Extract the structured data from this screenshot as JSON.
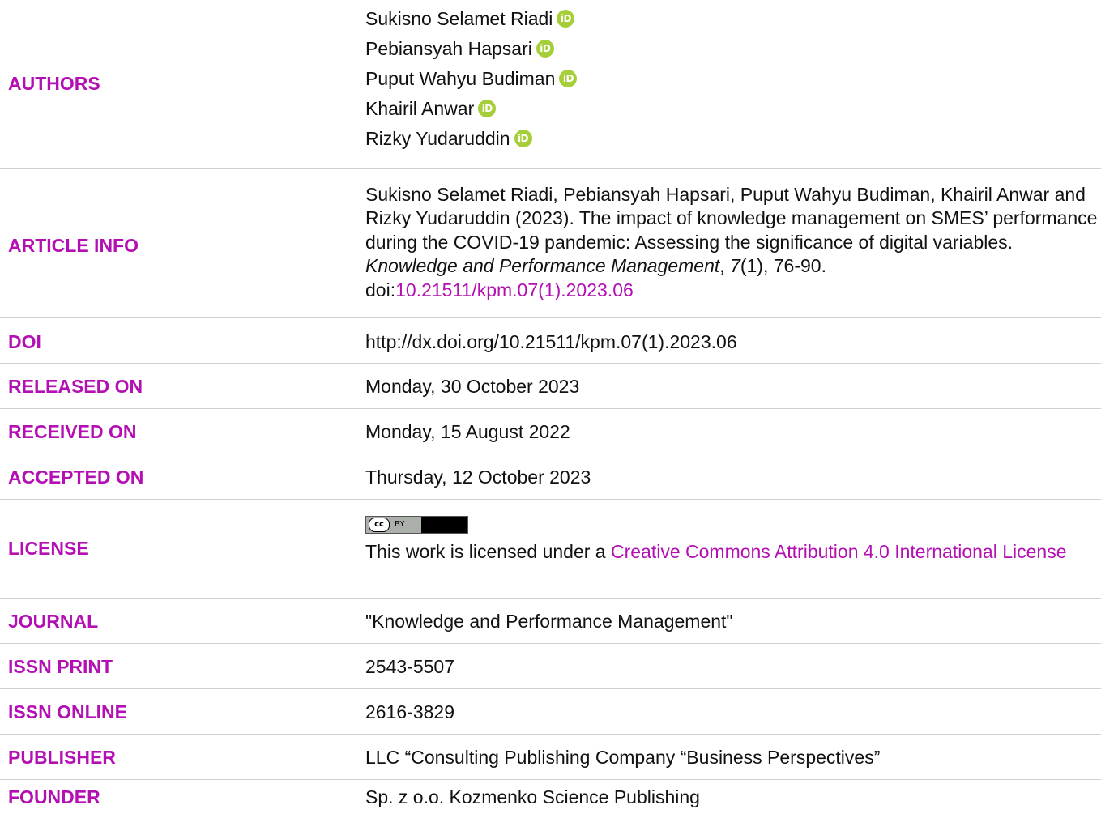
{
  "authors": {
    "label": "AUTHORS",
    "names": [
      "Sukisno Selamet Riadi",
      "Pebiansyah Hapsari",
      "Puput Wahyu Budiman",
      "Khairil Anwar",
      "Rizky Yudaruddin"
    ],
    "orcid_icon_text": "iD",
    "orcid_color": "#a6ce39"
  },
  "article_info": {
    "label": "ARTICLE INFO",
    "citation_start": "Sukisno Selamet Riadi, Pebiansyah Hapsari, Puput Wahyu Budiman, Khairil Anwar and Rizky Yudaruddin (2023). The impact of knowledge management on SMES’ performance during the COVID-19 pandemic: Assessing the significance of digital variables. ",
    "journal_italic": "Knowledge and Performance Management",
    "comma1": ", ",
    "volume_italic": "7",
    "pages": "(1), 76-90.",
    "doi_prefix": "doi:",
    "doi_link": "10.21511/kpm.07(1).2023.06"
  },
  "doi": {
    "label": "DOI",
    "value": "http://dx.doi.org/10.21511/kpm.07(1).2023.06"
  },
  "released": {
    "label": "RELEASED ON",
    "value": "Monday, 30 October 2023"
  },
  "received": {
    "label": "RECEIVED ON",
    "value": "Monday, 15 August 2022"
  },
  "accepted": {
    "label": "ACCEPTED ON",
    "value": "Thursday, 12 October 2023"
  },
  "license": {
    "label": "LICENSE",
    "badge_cc": "cc",
    "badge_by": "BY",
    "text": "This work is licensed under a ",
    "link": "Creative Commons Attribution 4.0 International License"
  },
  "journal": {
    "label": "JOURNAL",
    "value": "\"Knowledge and Performance Management\""
  },
  "issn_print": {
    "label": "ISSN PRINT",
    "value": "2543-5507"
  },
  "issn_online": {
    "label": "ISSN ONLINE",
    "value": "2616-3829"
  },
  "publisher": {
    "label": "PUBLISHER",
    "value": "LLC “Consulting Publishing Company “Business Perspectives”"
  },
  "founder": {
    "label": "FOUNDER",
    "value": "Sp. z o.o. Kozmenko Science Publishing"
  },
  "colors": {
    "label": "#b30fb3",
    "link": "#b30fb3",
    "divider": "#cfcfcf"
  }
}
